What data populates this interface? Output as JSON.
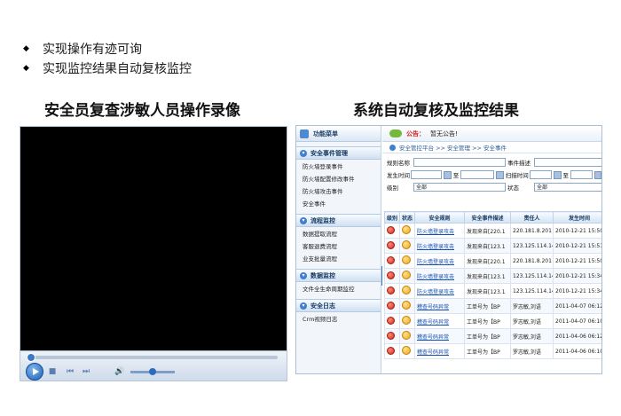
{
  "bullets": [
    "实现操作有迹可询",
    "实现监控结果自动复核监控"
  ],
  "left_heading": "安全员复查涉敏人员操作录像",
  "right_heading": "系统自动复核及监控结果",
  "player": {
    "seek_progress": 0.0,
    "volume_level": 0.5
  },
  "sidebar": {
    "title": "功能菜单",
    "groups": [
      {
        "title": "安全事件管理",
        "items": [
          "防火墙登录事件",
          "防火墙配置修改事件",
          "防火墙攻击事件",
          "安全事件"
        ]
      },
      {
        "title": "流程监控",
        "items": [
          "数据提取流程",
          "客服退费流程",
          "业支批量流程"
        ]
      },
      {
        "title": "数据监控",
        "items": [
          "文件全生命周期监控"
        ]
      },
      {
        "title": "安全日志",
        "items": [
          "Crm视频日志"
        ]
      }
    ]
  },
  "notice": {
    "label": "公告：",
    "text": "暂无公告!"
  },
  "breadcrumb": "安全管控平台 >> 安全管理 >> 安全事件",
  "form": {
    "rule_name_label": "规则名称",
    "event_desc_label": "事件描述",
    "occur_time_label": "发生时间",
    "to_label": "至",
    "scan_time_label": "扫描时间",
    "to_label2": "至",
    "level_label": "级别",
    "level_value": "全部",
    "status_label": "状态",
    "status_value": "全部"
  },
  "table": {
    "headers": [
      "级别",
      "状态",
      "安全规则",
      "安全事件描述",
      "责任人",
      "发生时间"
    ],
    "rows": [
      {
        "rule": "防火墙登录攻击",
        "desc": "发现来自[220.1",
        "owner": "220.181.8.201",
        "time": "2010-12-21 15:50"
      },
      {
        "rule": "防火墙登录攻击",
        "desc": "发现来自[123.1",
        "owner": "123.125.114.144",
        "time": "2010-12-21 15:51"
      },
      {
        "rule": "防火墙登录攻击",
        "desc": "发现来自[220.1",
        "owner": "220.181.8.201",
        "time": "2010-12-21 15:50"
      },
      {
        "rule": "防火墙登录攻击",
        "desc": "发现来自[123.1",
        "owner": "123.125.114.144",
        "time": "2010-12-21 15:34"
      },
      {
        "rule": "防火墙登录攻击",
        "desc": "发现来自[123.1",
        "owner": "123.125.114.144",
        "time": "2010-12-21 15:34"
      },
      {
        "rule": "稽查号码异常",
        "desc": "工单号为【BP",
        "owner": "罗志敏,刘语",
        "time": "2011-04-07 06:12"
      },
      {
        "rule": "稽查号码异常",
        "desc": "工单号为【BP",
        "owner": "罗志敏,刘语",
        "time": "2011-04-07 06:10"
      },
      {
        "rule": "稽查号码异常",
        "desc": "工单号为【BP",
        "owner": "罗志敏,刘语",
        "time": "2011-04-06 06:12"
      },
      {
        "rule": "稽查号码异常",
        "desc": "工单号为【BP",
        "owner": "罗志敏,刘语",
        "time": "2011-04-06 06:10"
      }
    ]
  }
}
